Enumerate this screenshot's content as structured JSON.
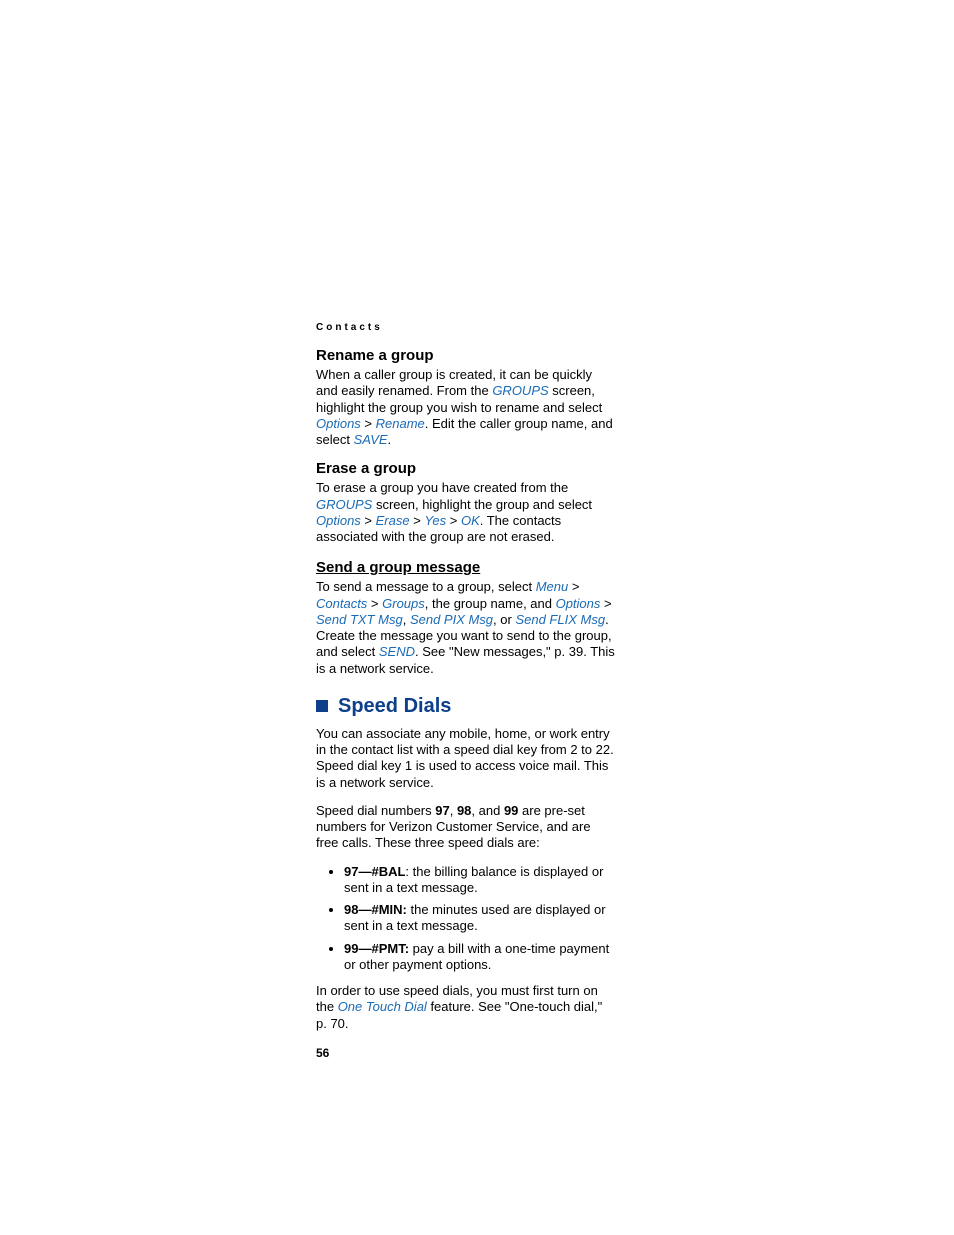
{
  "header": "Contacts",
  "rename": {
    "title": "Rename a group",
    "text_1": "When a caller group is created, it can be quickly and easily renamed. From the ",
    "groups": "GROUPS",
    "text_2": " screen, highlight the group you wish to rename and select ",
    "options": "Options",
    "gt1": " > ",
    "rename": "Rename",
    "text_3": ". Edit the caller group name, and select ",
    "save": "SAVE",
    "text_4": "."
  },
  "erase": {
    "title": "Erase a group",
    "text_1": "To erase a group you have created from the ",
    "groups": "GROUPS",
    "text_2": " screen, highlight the group and select ",
    "options": "Options",
    "gt1": " > ",
    "erase": "Erase",
    "gt2": " > ",
    "yes": "Yes",
    "gt3": " > ",
    "ok": "OK",
    "text_3": ". The contacts associated with the group are not erased."
  },
  "sendgroup": {
    "title": "Send a group message",
    "text_1": "To send a message to a group, select ",
    "menu": "Menu",
    "gt1": " > ",
    "contacts": "Contacts",
    "gt2": " > ",
    "groups": "Groups",
    "text_2": ", the group name, and ",
    "options": "Options",
    "gt3": " > ",
    "sendtxt": "Send TXT Msg",
    "comma1": ", ",
    "sendpix": "Send PIX Msg",
    "text_3": ", or ",
    "sendflix": "Send FLIX Msg",
    "text_4": ". Create the message you want to send to the group, and select ",
    "send": "SEND",
    "text_5": ". See \"New messages,\" p. 39. This is a network service."
  },
  "speeddials": {
    "title": "Speed Dials",
    "p1_a": "You can associate any mobile, home, or work entry in the contact list with a speed dial key from 2 to 22. Speed dial key 1 is used to access voice mail. This is a network service.",
    "p2_a": "Speed dial numbers ",
    "n97": "97",
    "p2_b": ", ",
    "n98": "98",
    "p2_c": ", and ",
    "n99": "99",
    "p2_d": " are pre-set numbers for Verizon Customer Service, and are free calls. These three speed dials are:",
    "li1_bold": "97—#BAL",
    "li1_rest": ": the billing balance is displayed or sent in a text message.",
    "li2_bold": "98—#MIN:",
    "li2_rest": " the minutes used are displayed or sent in a text message.",
    "li3_bold": "99—#PMT:",
    "li3_rest": " pay a bill with a one-time payment or other payment options.",
    "p3_a": "In order to use speed dials, you must first turn on the ",
    "onetouch": "One Touch Dial",
    "p3_b": " feature. See \"One-touch dial,\" p. 70."
  },
  "pagenum": "56"
}
